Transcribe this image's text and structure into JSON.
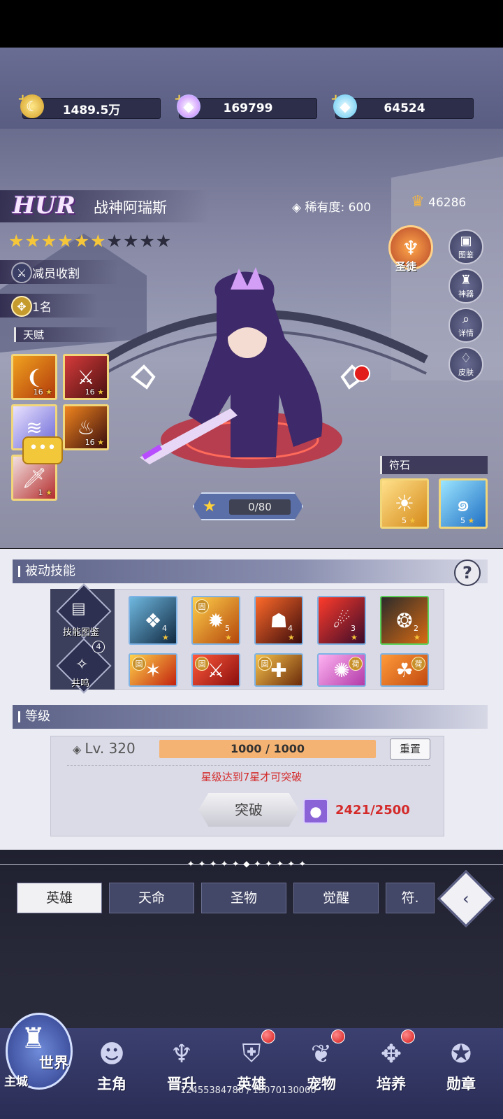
{
  "currencies": [
    {
      "icon": "gold-coin-icon",
      "plus": "+",
      "value": "1489.5万"
    },
    {
      "icon": "rainbow-gem-icon",
      "plus": "+",
      "value": "169799"
    },
    {
      "icon": "blue-diamond-icon",
      "plus": "+",
      "value": "64524"
    }
  ],
  "hero": {
    "rank": "HUR",
    "name": "战神阿瑞斯",
    "rarity_label": "稀有度:",
    "rarity_value": "600",
    "power": "46286",
    "stars_filled": 6,
    "stars_total": 10,
    "role": "减员收割",
    "place": "1名",
    "exp": "0/80"
  },
  "talents": {
    "title": "天赋",
    "items": [
      {
        "icon": "claw-slash-icon",
        "level": "16"
      },
      {
        "icon": "blood-sword-icon",
        "level": "16"
      },
      {
        "icon": "wind-blade-icon",
        "level": ""
      },
      {
        "icon": "flame-warrior-icon",
        "level": "16"
      },
      {
        "icon": "red-sword-icon",
        "level": "1"
      }
    ],
    "chat_icon": "chat-bubble-icon"
  },
  "right_buttons": [
    {
      "icon": "trident-crown-icon",
      "label": "圣徒"
    },
    {
      "icon": "book-icon",
      "label": "图鉴"
    },
    {
      "icon": "tower-icon",
      "label": "神器"
    },
    {
      "icon": "magnifier-icon",
      "label": "详情"
    },
    {
      "icon": "shirt-icon",
      "label": "皮肤"
    }
  ],
  "runes": {
    "title": "符石",
    "items": [
      {
        "icon": "sun-rune-icon",
        "level": "5"
      },
      {
        "icon": "swirl-rune-icon",
        "level": "5"
      }
    ]
  },
  "passive": {
    "title": "被动技能",
    "help": "?",
    "side": [
      {
        "icon": "skill-book-icon",
        "label": "技能图鉴"
      },
      {
        "icon": "resonance-icon",
        "label": "共鸣",
        "badge": "4"
      }
    ],
    "row1": [
      {
        "icon": "ice-vortex-icon",
        "level": "4",
        "fixed": ""
      },
      {
        "icon": "flame-burst-icon",
        "level": "5",
        "fixed": "固"
      },
      {
        "icon": "demon-face-icon",
        "level": "4",
        "fixed": ""
      },
      {
        "icon": "fire-claw-icon",
        "level": "3",
        "fixed": ""
      },
      {
        "icon": "dark-beast-icon",
        "level": "2",
        "fixed": ""
      }
    ],
    "row2": [
      {
        "icon": "fire-slash-icon",
        "fixed": "固"
      },
      {
        "icon": "red-blade-icon",
        "fixed": "固"
      },
      {
        "icon": "golden-cross-icon",
        "fixed": "固"
      },
      {
        "icon": "pink-burst-icon",
        "fixed": "荷"
      },
      {
        "icon": "fire-fox-icon",
        "fixed": "荷"
      }
    ]
  },
  "level": {
    "title": "等级",
    "lv": "Lv. 320",
    "exp_text": "1000 / 1000",
    "exp_fraction": 1.0,
    "reset": "重置",
    "warning": "星级达到7星才可突破",
    "break": "突破",
    "orb_count": "2421/2500"
  },
  "tabs": [
    "英雄",
    "天命",
    "圣物",
    "觉醒",
    "符."
  ],
  "nav": [
    {
      "icon": "world-castle-icon",
      "label": "世界",
      "sub": "主城",
      "dot": false
    },
    {
      "icon": "hero-helmet-icon",
      "label": "主角",
      "dot": false
    },
    {
      "icon": "wings-icon",
      "label": "晋升",
      "dot": false
    },
    {
      "icon": "knight-helmet-icon",
      "label": "英雄",
      "dot": true
    },
    {
      "icon": "pet-icon",
      "label": "宠物",
      "dot": true
    },
    {
      "icon": "compass-icon",
      "label": "培养",
      "dot": true
    },
    {
      "icon": "medal-icon",
      "label": "勋章",
      "dot": false
    }
  ],
  "version": "12455384780 / 15070130000",
  "colors": {
    "accent": "#f5b373",
    "warning": "#d42a2a",
    "panel": "#ebebf3",
    "nav": "#2a2d55"
  }
}
